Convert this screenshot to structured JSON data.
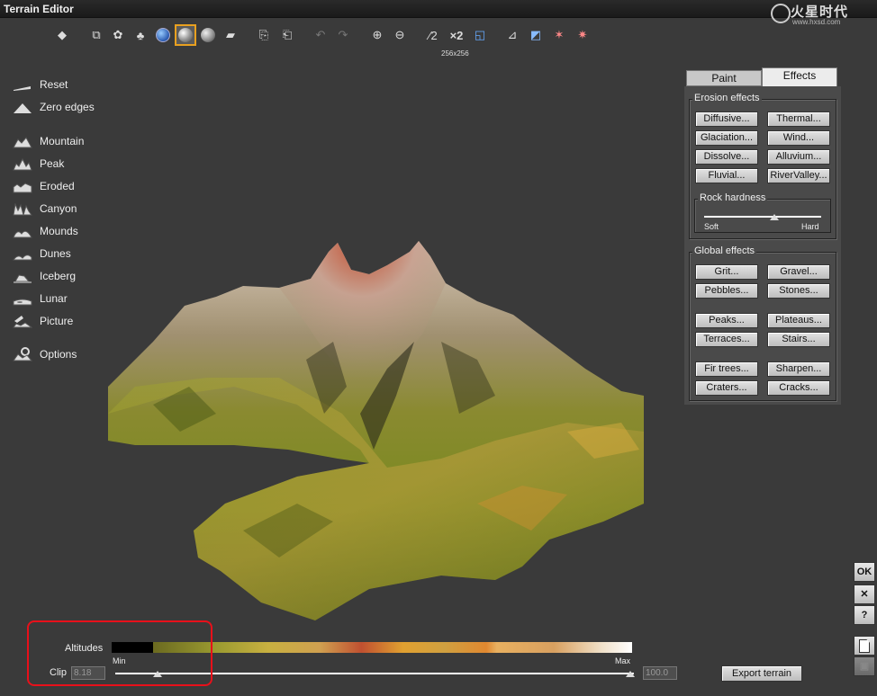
{
  "window": {
    "title": "Terrain Editor"
  },
  "logo": {
    "text": "火星时代",
    "url_text": "www.hxsd.com"
  },
  "toolbar": {
    "buttons": [
      {
        "name": "view-mode-icon",
        "glyph": "◆"
      },
      {
        "name": "zoom-object-icon",
        "glyph": "⧉"
      },
      {
        "name": "leaf-icon",
        "glyph": "✿"
      },
      {
        "name": "primitives-icon",
        "glyph": "♣"
      },
      {
        "name": "globe-icon",
        "glyph": ""
      },
      {
        "name": "sphere-icon",
        "glyph": ""
      },
      {
        "name": "grey-sphere-icon",
        "glyph": ""
      },
      {
        "name": "flat-terrain-icon",
        "glyph": "▰"
      },
      {
        "name": "copy-icon",
        "glyph": "⎘"
      },
      {
        "name": "paste-icon",
        "glyph": "⎗"
      },
      {
        "name": "undo-icon",
        "glyph": "↶"
      },
      {
        "name": "redo-icon",
        "glyph": "↷"
      },
      {
        "name": "zoom-in-icon",
        "glyph": "⊕"
      },
      {
        "name": "zoom-out-icon",
        "glyph": "⊖"
      },
      {
        "name": "half-resolution-icon",
        "glyph": "⁄2"
      },
      {
        "name": "double-resolution-icon",
        "glyph": "×2"
      },
      {
        "name": "resize-icon",
        "glyph": "◱"
      },
      {
        "name": "invert-icon",
        "glyph": "⊿"
      },
      {
        "name": "mirror-icon",
        "glyph": "◩"
      },
      {
        "name": "random-icon",
        "glyph": "✶"
      },
      {
        "name": "randomize-icon",
        "glyph": "✷"
      }
    ],
    "resolution": "256x256"
  },
  "leftmenu": {
    "items": [
      {
        "label": "Reset",
        "icon": "reset-icon"
      },
      {
        "label": "Zero edges",
        "icon": "zero-edges-icon"
      },
      {
        "label": "Mountain",
        "icon": "mountain-icon"
      },
      {
        "label": "Peak",
        "icon": "peak-icon"
      },
      {
        "label": "Eroded",
        "icon": "eroded-icon"
      },
      {
        "label": "Canyon",
        "icon": "canyon-icon"
      },
      {
        "label": "Mounds",
        "icon": "mounds-icon"
      },
      {
        "label": "Dunes",
        "icon": "dunes-icon"
      },
      {
        "label": "Iceberg",
        "icon": "iceberg-icon"
      },
      {
        "label": "Lunar",
        "icon": "lunar-icon"
      },
      {
        "label": "Picture",
        "icon": "picture-icon"
      },
      {
        "label": "Options",
        "icon": "options-icon"
      }
    ]
  },
  "panel": {
    "tabs": {
      "paint": "Paint",
      "effects": "Effects"
    },
    "erosion": {
      "title": "Erosion effects",
      "buttons": [
        "Diffusive...",
        "Thermal...",
        "Glaciation...",
        "Wind...",
        "Dissolve...",
        "Alluvium...",
        "Fluvial...",
        "RiverValley..."
      ],
      "rock_hardness": {
        "title": "Rock hardness",
        "soft": "Soft",
        "hard": "Hard",
        "value": 0.6
      }
    },
    "global": {
      "title": "Global effects",
      "buttons": [
        "Grit...",
        "Gravel...",
        "Pebbles...",
        "Stones...",
        "Peaks...",
        "Plateaus...",
        "Terraces...",
        "Stairs...",
        "Fir trees...",
        "Sharpen...",
        "Craters...",
        "Cracks..."
      ]
    }
  },
  "bottom": {
    "altitudes_label": "Altitudes",
    "min_label": "Min",
    "max_label": "Max",
    "clip_label": "Clip",
    "clip_min": "8.18",
    "clip_max": "100.0",
    "clip_min_fraction": 0.082,
    "export_label": "Export terrain"
  },
  "rightbuttons": {
    "ok": "OK",
    "cancel": "✕",
    "help": "?"
  }
}
